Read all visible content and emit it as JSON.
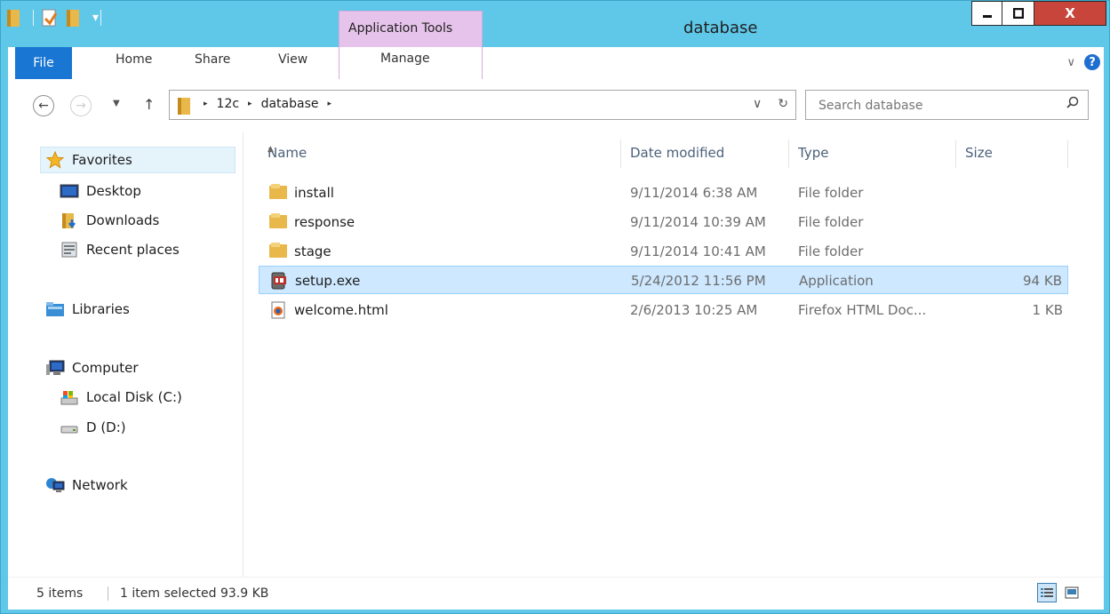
{
  "window": {
    "title": "database",
    "context_tab": "Application Tools",
    "min_glyph": "▬",
    "max_glyph": "☐",
    "close_glyph": "X"
  },
  "ribbon": {
    "tabs": [
      "File",
      "Home",
      "Share",
      "View",
      "Manage"
    ],
    "help_glyph": "?",
    "expand_glyph": "∨"
  },
  "address": {
    "crumbs": [
      "12c",
      "database"
    ],
    "separator_glyph": "▸",
    "dropdown_glyph": "∨",
    "refresh_glyph": "↻"
  },
  "search": {
    "placeholder": "Search database"
  },
  "nav": {
    "favorites": "Favorites",
    "desktop": "Desktop",
    "downloads": "Downloads",
    "recent": "Recent places",
    "libraries": "Libraries",
    "computer": "Computer",
    "local_disk": "Local Disk (C:)",
    "d_drive": "D (D:)",
    "network": "Network"
  },
  "columns": {
    "name": "Name",
    "date": "Date modified",
    "type": "Type",
    "size": "Size"
  },
  "files": [
    {
      "name": "install",
      "date": "9/11/2014 6:38 AM",
      "type": "File folder",
      "size": "",
      "icon": "folder-icon"
    },
    {
      "name": "response",
      "date": "9/11/2014 10:39 AM",
      "type": "File folder",
      "size": "",
      "icon": "folder-icon"
    },
    {
      "name": "stage",
      "date": "9/11/2014 10:41 AM",
      "type": "File folder",
      "size": "",
      "icon": "folder-icon"
    },
    {
      "name": "setup.exe",
      "date": "5/24/2012 11:56 PM",
      "type": "Application",
      "size": "94 KB",
      "icon": "application-icon",
      "selected": true
    },
    {
      "name": "welcome.html",
      "date": "2/6/2013 10:25 AM",
      "type": "Firefox HTML Doc...",
      "size": "1 KB",
      "icon": "html-file-icon"
    }
  ],
  "status": {
    "count": "5 items",
    "selection": "1 item selected  93.9 KB"
  },
  "colors": {
    "accent": "#5fc7e8",
    "file_tab": "#1976d2",
    "context_tab": "#e6c3ea",
    "selection": "#cde8ff",
    "close": "#c7453a"
  }
}
